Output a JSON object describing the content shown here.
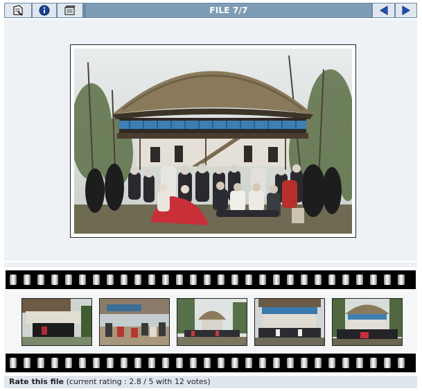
{
  "toolbar": {
    "title": "FILE 7/7",
    "buttons": [
      {
        "name": "return-to-gallery",
        "icon": "gallery-return-icon"
      },
      {
        "name": "file-info",
        "icon": "info-icon"
      },
      {
        "name": "slideshow",
        "icon": "slideshow-icon"
      },
      {
        "name": "previous",
        "icon": "arrow-left-icon"
      },
      {
        "name": "next",
        "icon": "arrow-right-icon"
      }
    ]
  },
  "main_photo": {
    "subject": "group photo in front of traditional wooden house with thatched roof"
  },
  "filmstrip": {
    "thumbnails": [
      {
        "subject": "group in front of wooden house"
      },
      {
        "subject": "people sitting in courtyard"
      },
      {
        "subject": "group in front of thatched house"
      },
      {
        "subject": "group in front of two-storey house"
      },
      {
        "subject": "group in front of thatched house"
      }
    ]
  },
  "rating": {
    "label": "Rate this file",
    "detail": "(current rating : 2.8 / 5 with 12 votes)"
  },
  "colors": {
    "toolbar_bg": "#6b8aa5",
    "title_bg": "#7f9cb6",
    "panel_bg": "#eef2f6",
    "rating_bg": "#dfe6ee"
  }
}
